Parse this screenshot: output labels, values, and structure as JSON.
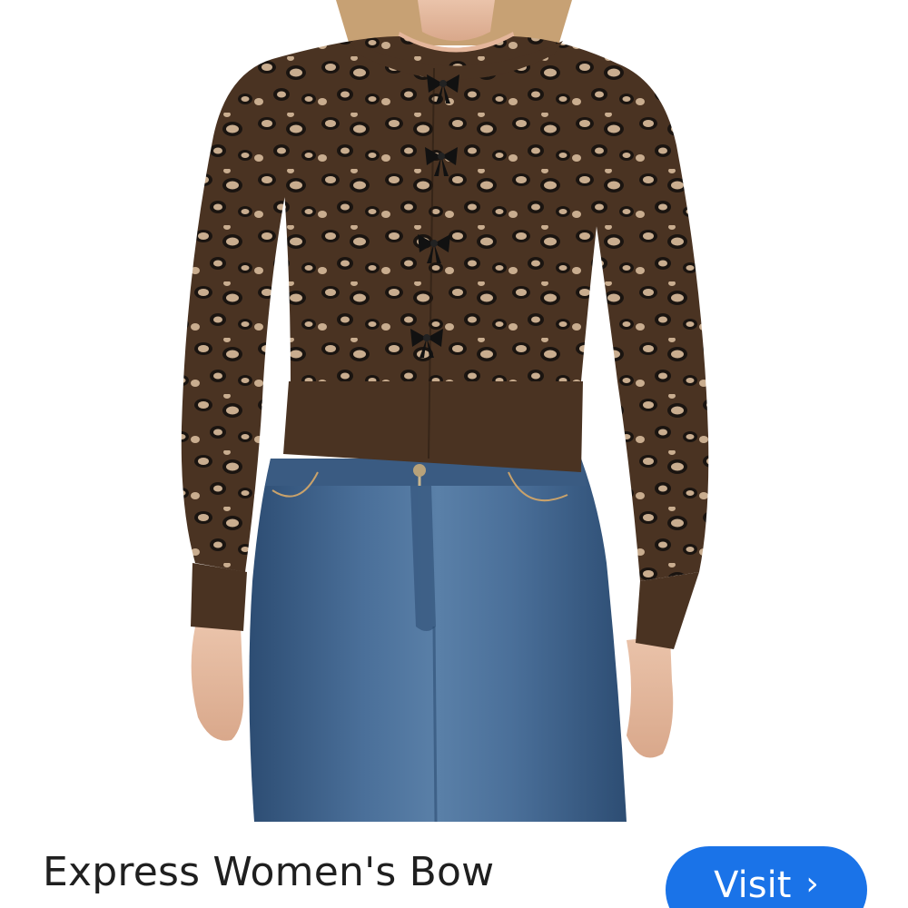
{
  "product": {
    "title": "Express Women's Bow",
    "image_alt": "Model wearing leopard print cardigan with bow buttons and blue jeans"
  },
  "actions": {
    "visit_label": "Visit",
    "visit_icon": "chevron-right-icon",
    "visit_glyph": "›"
  },
  "colors": {
    "accent": "#1a73e8",
    "title_text": "#1f1f1f",
    "sweater_base": "#4a3322",
    "leopard_spot": "#c9ad8f",
    "leopard_ring": "#1a1410",
    "denim": "#3d5f86",
    "skin": "#e4b69b",
    "hair": "#c7a174"
  }
}
